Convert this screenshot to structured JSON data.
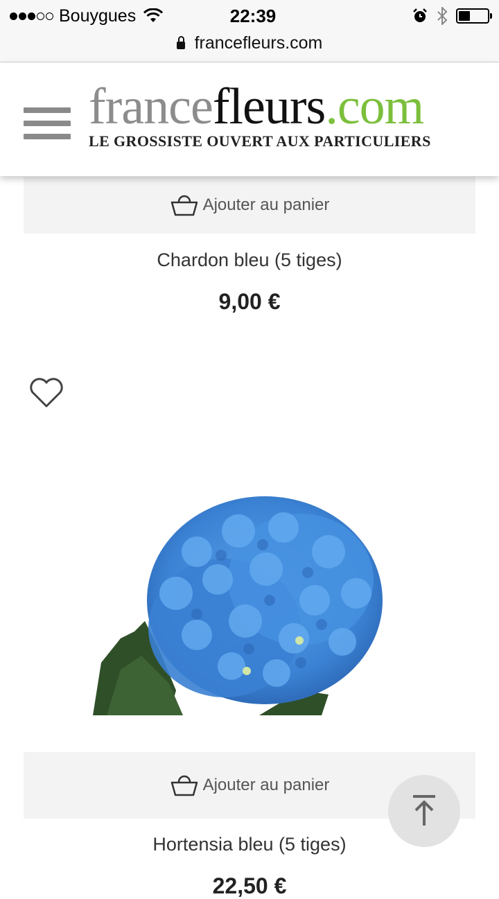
{
  "status_bar": {
    "carrier": "Bouygues",
    "time": "22:39",
    "battery_level": 0.4,
    "url": "francefleurs.com"
  },
  "header": {
    "logo_france": "france",
    "logo_fleurs": "fleurs",
    "logo_com": ".com",
    "tagline": "LE GROSSISTE OUVERT AUX PARTICULIERS",
    "menu_icon": "hamburger-icon"
  },
  "products": [
    {
      "add_to_cart_label": "Ajouter au panier",
      "name": "Chardon bleu (5 tiges)",
      "price": "9,00 €"
    },
    {
      "add_to_cart_label": "Ajouter au panier",
      "name": "Hortensia bleu (5 tiges)",
      "price": "22,50 €",
      "image": "blue-hydrangea"
    }
  ],
  "colors": {
    "brand_green": "#7cbf3c",
    "brand_grey": "#8c8c8c",
    "hydrangea_blue": "#3f86d6"
  }
}
